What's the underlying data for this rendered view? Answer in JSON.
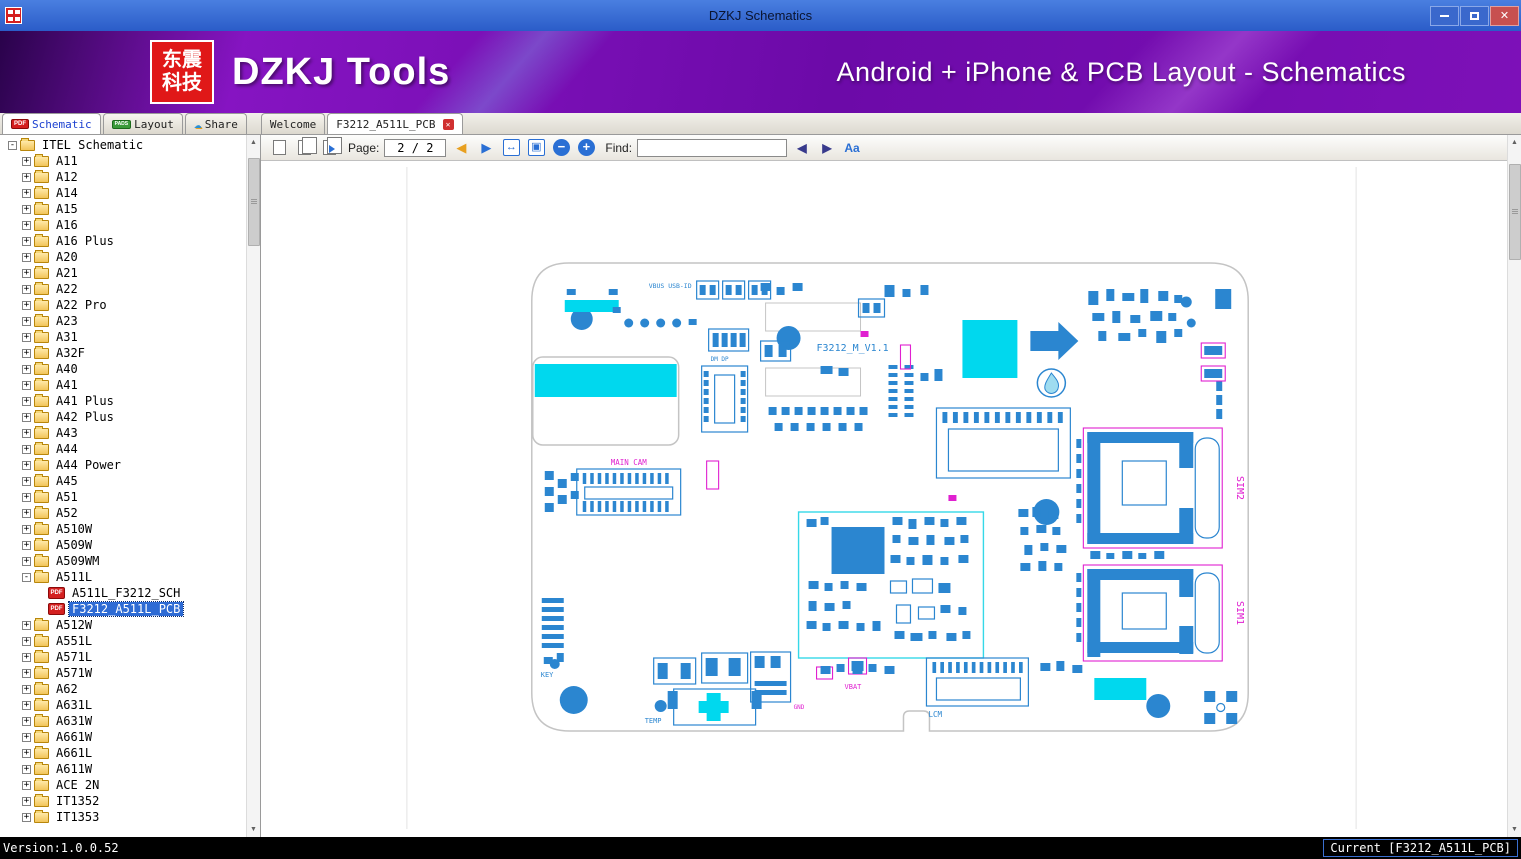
{
  "window": {
    "title": "DZKJ Schematics"
  },
  "icons": {
    "arrow_up": "▲",
    "arrow_down": "▼",
    "nav_back": "◀",
    "nav_forward": "▶",
    "zoom_out": "−",
    "zoom_in": "+",
    "fit_width": "↔",
    "fit_page": "▣",
    "find_prev": "◀",
    "find_next": "▶",
    "font_size": "Aa",
    "close": "✕",
    "cloud": "☁"
  },
  "banner": {
    "logo_line1": "东震",
    "logo_line2": "科技",
    "title": "DZKJ Tools",
    "subtitle": "Android + iPhone & PCB Layout - Schematics"
  },
  "tabs": {
    "group_tabs": [
      {
        "label": "Schematic",
        "badge": "PDF"
      },
      {
        "label": "Layout",
        "badge": "PADS"
      },
      {
        "label": "Share",
        "badge": ""
      }
    ],
    "doc_tabs": [
      {
        "label": "Welcome"
      },
      {
        "label": "F3212_A511L_PCB"
      }
    ]
  },
  "toolbar": {
    "page_label": "Page:",
    "page_value": "2 / 2",
    "find_label": "Find:",
    "find_value": ""
  },
  "sidebar": {
    "items": [
      {
        "label": "ITEL Schematic",
        "level": 0,
        "icon": "folder",
        "exp": "minus",
        "selected": false
      },
      {
        "label": "A11",
        "level": 1,
        "icon": "folder",
        "exp": "plus",
        "selected": false
      },
      {
        "label": "A12",
        "level": 1,
        "icon": "folder",
        "exp": "plus",
        "selected": false
      },
      {
        "label": "A14",
        "level": 1,
        "icon": "folder",
        "exp": "plus",
        "selected": false
      },
      {
        "label": "A15",
        "level": 1,
        "icon": "folder",
        "exp": "plus",
        "selected": false
      },
      {
        "label": "A16",
        "level": 1,
        "icon": "folder",
        "exp": "plus",
        "selected": false
      },
      {
        "label": "A16 Plus",
        "level": 1,
        "icon": "folder",
        "exp": "plus",
        "selected": false
      },
      {
        "label": "A20",
        "level": 1,
        "icon": "folder",
        "exp": "plus",
        "selected": false
      },
      {
        "label": "A21",
        "level": 1,
        "icon": "folder",
        "exp": "plus",
        "selected": false
      },
      {
        "label": "A22",
        "level": 1,
        "icon": "folder",
        "exp": "plus",
        "selected": false
      },
      {
        "label": "A22 Pro",
        "level": 1,
        "icon": "folder",
        "exp": "plus",
        "selected": false
      },
      {
        "label": "A23",
        "level": 1,
        "icon": "folder",
        "exp": "plus",
        "selected": false
      },
      {
        "label": "A31",
        "level": 1,
        "icon": "folder",
        "exp": "plus",
        "selected": false
      },
      {
        "label": "A32F",
        "level": 1,
        "icon": "folder",
        "exp": "plus",
        "selected": false
      },
      {
        "label": "A40",
        "level": 1,
        "icon": "folder",
        "exp": "plus",
        "selected": false
      },
      {
        "label": "A41",
        "level": 1,
        "icon": "folder",
        "exp": "plus",
        "selected": false
      },
      {
        "label": "A41 Plus",
        "level": 1,
        "icon": "folder",
        "exp": "plus",
        "selected": false
      },
      {
        "label": "A42 Plus",
        "level": 1,
        "icon": "folder",
        "exp": "plus",
        "selected": false
      },
      {
        "label": "A43",
        "level": 1,
        "icon": "folder",
        "exp": "plus",
        "selected": false
      },
      {
        "label": "A44",
        "level": 1,
        "icon": "folder",
        "exp": "plus",
        "selected": false
      },
      {
        "label": "A44 Power",
        "level": 1,
        "icon": "folder",
        "exp": "plus",
        "selected": false
      },
      {
        "label": "A45",
        "level": 1,
        "icon": "folder",
        "exp": "plus",
        "selected": false
      },
      {
        "label": "A51",
        "level": 1,
        "icon": "folder",
        "exp": "plus",
        "selected": false
      },
      {
        "label": "A52",
        "level": 1,
        "icon": "folder",
        "exp": "plus",
        "selected": false
      },
      {
        "label": "A510W",
        "level": 1,
        "icon": "folder",
        "exp": "plus",
        "selected": false
      },
      {
        "label": "A509W",
        "level": 1,
        "icon": "folder",
        "exp": "plus",
        "selected": false
      },
      {
        "label": "A509WM",
        "level": 1,
        "icon": "folder",
        "exp": "plus",
        "selected": false
      },
      {
        "label": "A511L",
        "level": 1,
        "icon": "folder",
        "exp": "minus",
        "selected": false
      },
      {
        "label": "A511L_F3212_SCH",
        "level": 2,
        "icon": "pdf",
        "exp": "leaf",
        "selected": false
      },
      {
        "label": "F3212_A511L_PCB",
        "level": 2,
        "icon": "pdf",
        "exp": "leaf",
        "selected": true
      },
      {
        "label": "A512W",
        "level": 1,
        "icon": "folder",
        "exp": "plus",
        "selected": false
      },
      {
        "label": "A551L",
        "level": 1,
        "icon": "folder",
        "exp": "plus",
        "selected": false
      },
      {
        "label": "A571L",
        "level": 1,
        "icon": "folder",
        "exp": "plus",
        "selected": false
      },
      {
        "label": "A571W",
        "level": 1,
        "icon": "folder",
        "exp": "plus",
        "selected": false
      },
      {
        "label": "A62",
        "level": 1,
        "icon": "folder",
        "exp": "plus",
        "selected": false
      },
      {
        "label": "A631L",
        "level": 1,
        "icon": "folder",
        "exp": "plus",
        "selected": false
      },
      {
        "label": "A631W",
        "level": 1,
        "icon": "folder",
        "exp": "plus",
        "selected": false
      },
      {
        "label": "A661W",
        "level": 1,
        "icon": "folder",
        "exp": "plus",
        "selected": false
      },
      {
        "label": "A661L",
        "level": 1,
        "icon": "folder",
        "exp": "plus",
        "selected": false
      },
      {
        "label": "A611W",
        "level": 1,
        "icon": "folder",
        "exp": "plus",
        "selected": false
      },
      {
        "label": "ACE 2N",
        "level": 1,
        "icon": "folder",
        "exp": "plus",
        "selected": false
      },
      {
        "label": "IT1352",
        "level": 1,
        "icon": "folder",
        "exp": "plus",
        "selected": false
      },
      {
        "label": "IT1353",
        "level": 1,
        "icon": "folder",
        "exp": "plus",
        "selected": false
      }
    ]
  },
  "pcb": {
    "board_label": "F3212_M_V1.1",
    "main_cam_label": "MAIN CAM",
    "lcm_label": "LCM",
    "sim1_label": "SIM1",
    "sim2_label": "SIM2",
    "key_label": "KEY",
    "temp_label": "TEMP",
    "vbat_label": "VBAT",
    "gnd_label": "GND",
    "vbus_label": "VBUS USB-ID",
    "dmdp_label": "DM DP",
    "colors": {
      "component_blue": "#2b86d0",
      "highlight_cyan": "#00d8ee",
      "accent_magenta": "#e020d0"
    }
  },
  "status": {
    "version": "Version:1.0.0.52",
    "current_doc": "Current [F3212_A511L_PCB]"
  }
}
